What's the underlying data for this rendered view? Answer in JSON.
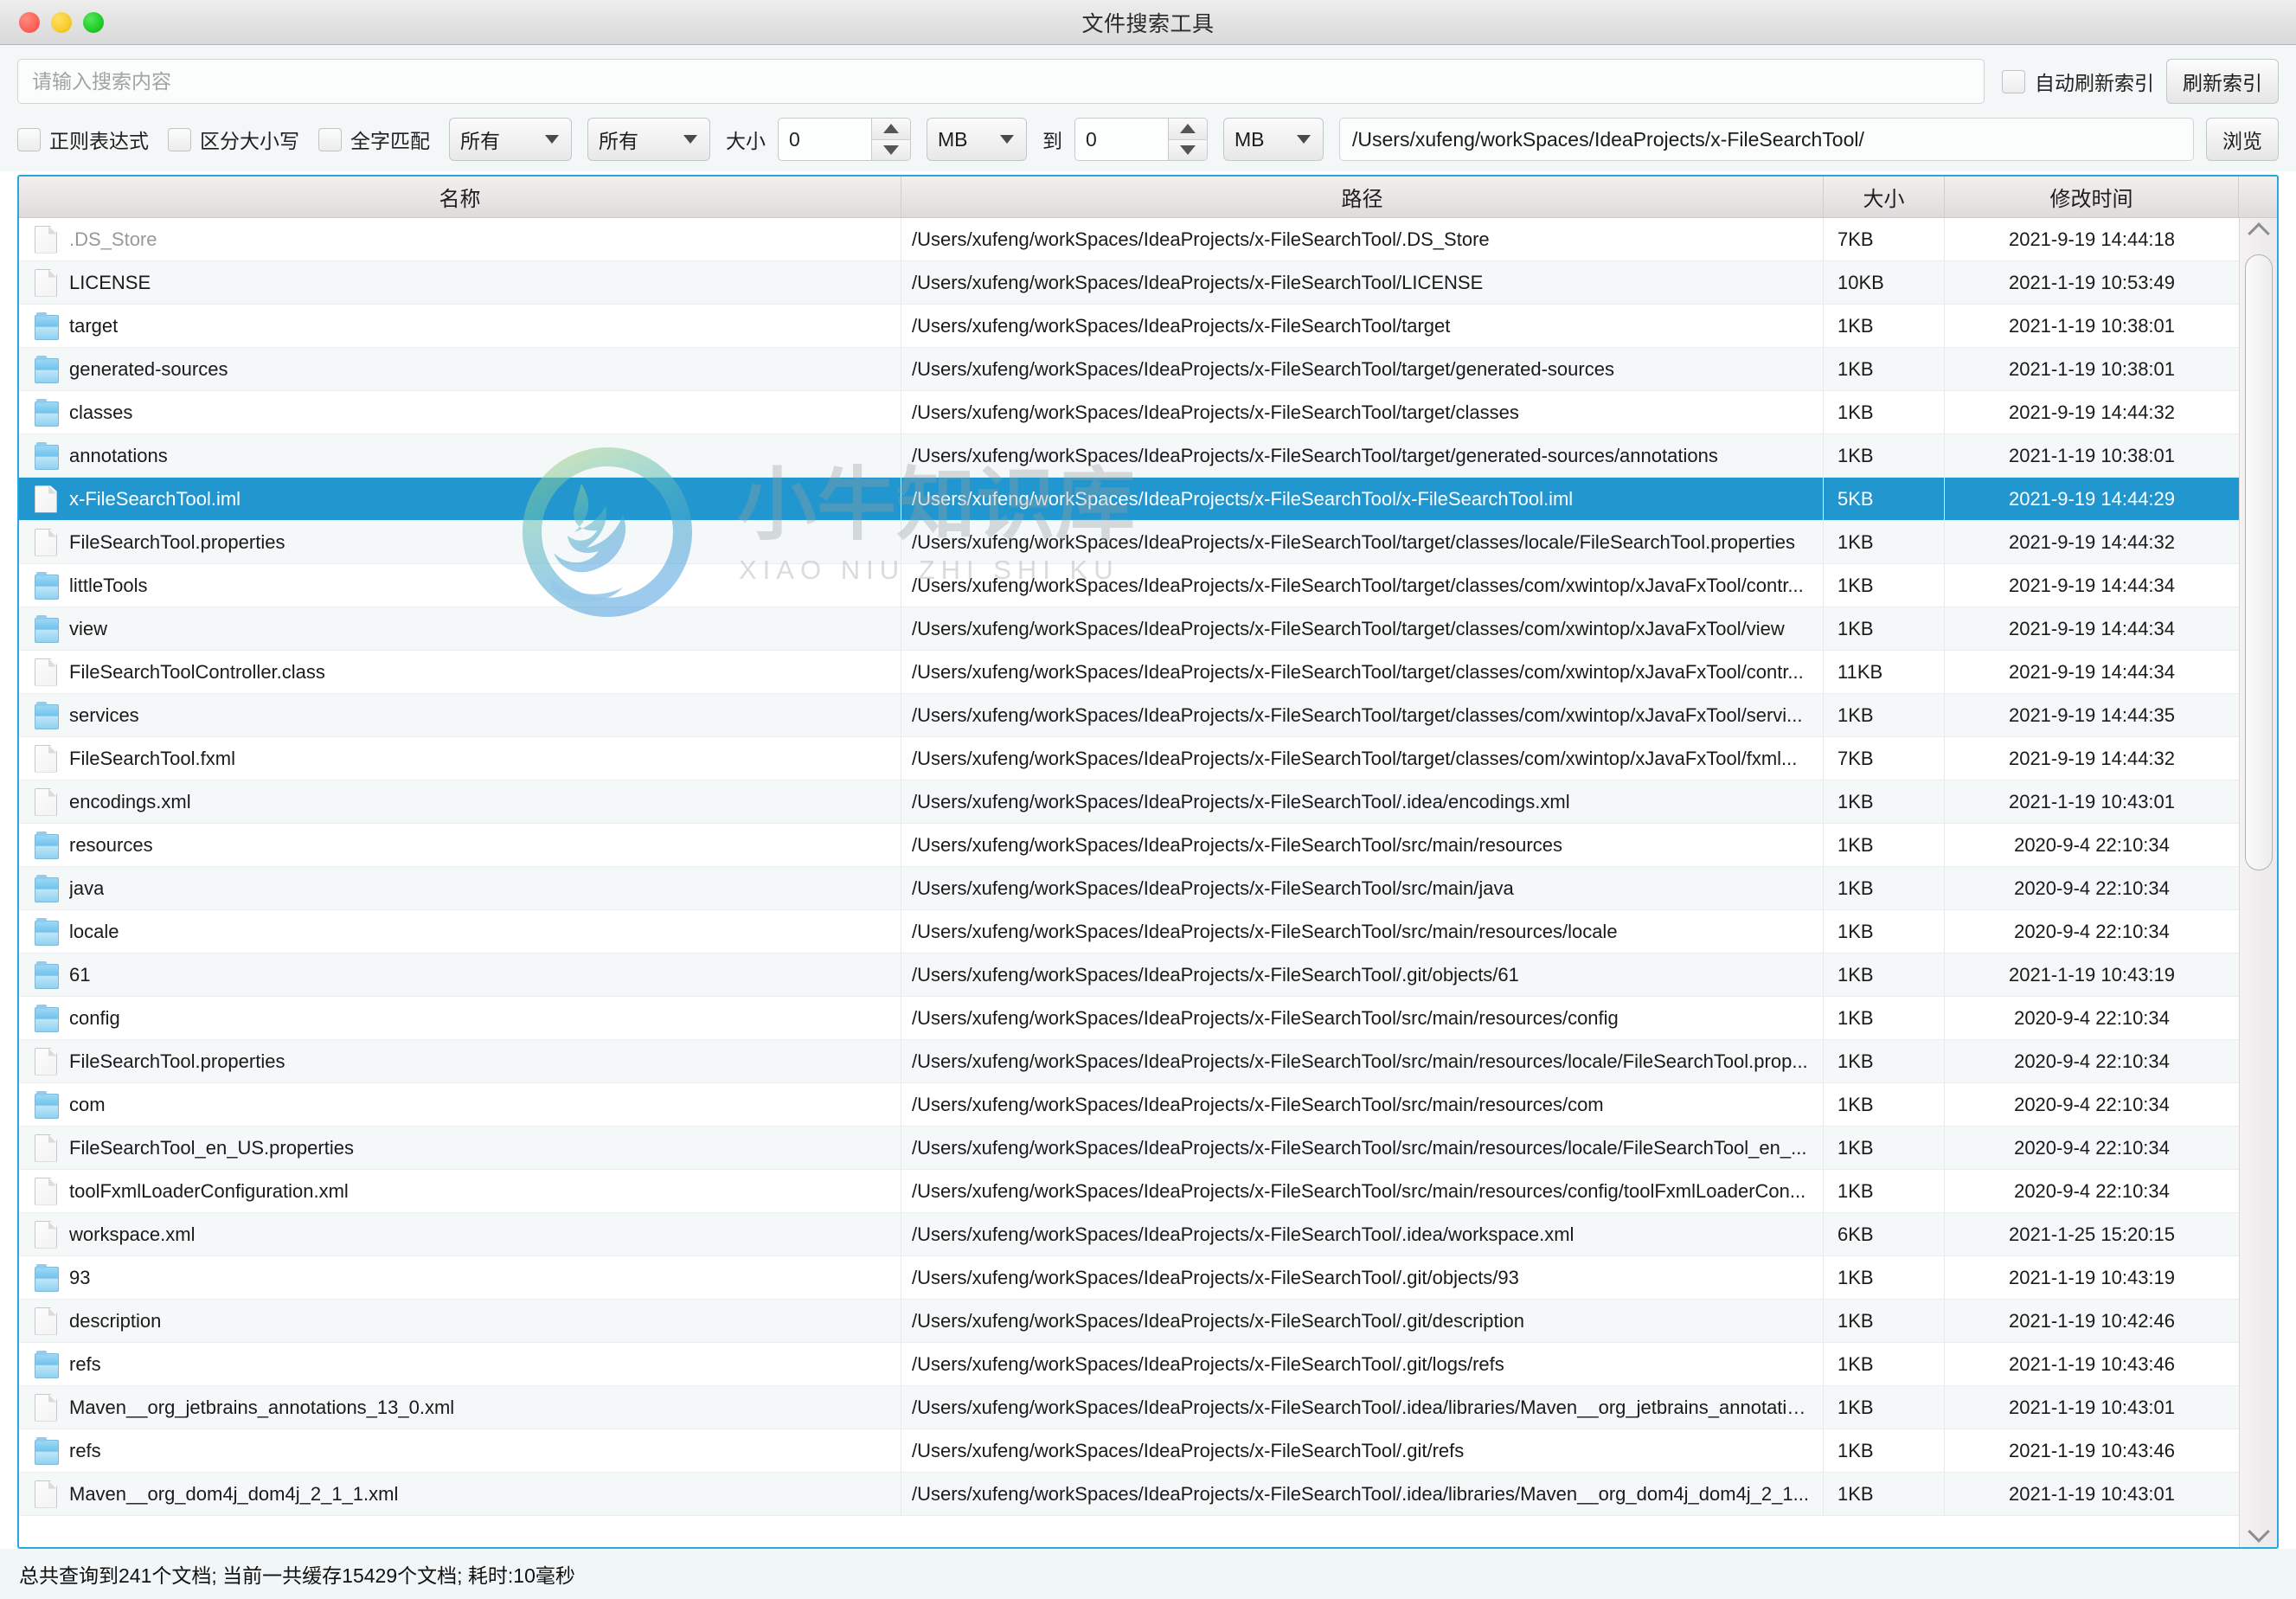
{
  "window": {
    "title": "文件搜索工具",
    "traffic_lights": [
      "close",
      "minimize",
      "zoom"
    ]
  },
  "toolbar": {
    "search_placeholder": "请输入搜索内容",
    "search_value": "",
    "auto_refresh_label": "自动刷新索引",
    "auto_refresh_checked": false,
    "refresh_index_label": "刷新索引",
    "regex_label": "正则表达式",
    "regex_checked": false,
    "case_label": "区分大小写",
    "case_checked": false,
    "wholeword_label": "全字匹配",
    "wholeword_checked": false,
    "type_combo_value": "所有",
    "scope_combo_value": "所有",
    "size_label": "大小",
    "size_from_value": "0",
    "size_from_unit": "MB",
    "to_label": "到",
    "size_to_value": "0",
    "size_to_unit": "MB",
    "path_value": "/Users/xufeng/workSpaces/IdeaProjects/x-FileSearchTool/",
    "browse_label": "浏览"
  },
  "table": {
    "columns": [
      "名称",
      "路径",
      "大小",
      "修改时间"
    ],
    "selected_index": 6,
    "rows": [
      {
        "icon": "file",
        "name": ".DS_Store",
        "dim": true,
        "path": "/Users/xufeng/workSpaces/IdeaProjects/x-FileSearchTool/.DS_Store",
        "size": "7KB",
        "time": "2021-9-19 14:44:18"
      },
      {
        "icon": "file",
        "name": "LICENSE",
        "dim": false,
        "path": "/Users/xufeng/workSpaces/IdeaProjects/x-FileSearchTool/LICENSE",
        "size": "10KB",
        "time": "2021-1-19 10:53:49"
      },
      {
        "icon": "folder",
        "name": "target",
        "dim": false,
        "path": "/Users/xufeng/workSpaces/IdeaProjects/x-FileSearchTool/target",
        "size": "1KB",
        "time": "2021-1-19 10:38:01"
      },
      {
        "icon": "folder",
        "name": "generated-sources",
        "dim": false,
        "path": "/Users/xufeng/workSpaces/IdeaProjects/x-FileSearchTool/target/generated-sources",
        "size": "1KB",
        "time": "2021-1-19 10:38:01"
      },
      {
        "icon": "folder",
        "name": "classes",
        "dim": false,
        "path": "/Users/xufeng/workSpaces/IdeaProjects/x-FileSearchTool/target/classes",
        "size": "1KB",
        "time": "2021-9-19 14:44:32"
      },
      {
        "icon": "folder",
        "name": "annotations",
        "dim": false,
        "path": "/Users/xufeng/workSpaces/IdeaProjects/x-FileSearchTool/target/generated-sources/annotations",
        "size": "1KB",
        "time": "2021-1-19 10:38:01"
      },
      {
        "icon": "file",
        "name": "x-FileSearchTool.iml",
        "dim": false,
        "path": "/Users/xufeng/workSpaces/IdeaProjects/x-FileSearchTool/x-FileSearchTool.iml",
        "size": "5KB",
        "time": "2021-9-19 14:44:29"
      },
      {
        "icon": "file",
        "name": "FileSearchTool.properties",
        "dim": false,
        "path": "/Users/xufeng/workSpaces/IdeaProjects/x-FileSearchTool/target/classes/locale/FileSearchTool.properties",
        "size": "1KB",
        "time": "2021-9-19 14:44:32"
      },
      {
        "icon": "folder",
        "name": "littleTools",
        "dim": false,
        "path": "/Users/xufeng/workSpaces/IdeaProjects/x-FileSearchTool/target/classes/com/xwintop/xJavaFxTool/contr...",
        "size": "1KB",
        "time": "2021-9-19 14:44:34"
      },
      {
        "icon": "folder",
        "name": "view",
        "dim": false,
        "path": "/Users/xufeng/workSpaces/IdeaProjects/x-FileSearchTool/target/classes/com/xwintop/xJavaFxTool/view",
        "size": "1KB",
        "time": "2021-9-19 14:44:34"
      },
      {
        "icon": "file",
        "name": "FileSearchToolController.class",
        "dim": false,
        "path": "/Users/xufeng/workSpaces/IdeaProjects/x-FileSearchTool/target/classes/com/xwintop/xJavaFxTool/contr...",
        "size": "11KB",
        "time": "2021-9-19 14:44:34"
      },
      {
        "icon": "folder",
        "name": "services",
        "dim": false,
        "path": "/Users/xufeng/workSpaces/IdeaProjects/x-FileSearchTool/target/classes/com/xwintop/xJavaFxTool/servi...",
        "size": "1KB",
        "time": "2021-9-19 14:44:35"
      },
      {
        "icon": "file",
        "name": "FileSearchTool.fxml",
        "dim": false,
        "path": "/Users/xufeng/workSpaces/IdeaProjects/x-FileSearchTool/target/classes/com/xwintop/xJavaFxTool/fxml...",
        "size": "7KB",
        "time": "2021-9-19 14:44:32"
      },
      {
        "icon": "file",
        "name": "encodings.xml",
        "dim": false,
        "path": "/Users/xufeng/workSpaces/IdeaProjects/x-FileSearchTool/.idea/encodings.xml",
        "size": "1KB",
        "time": "2021-1-19 10:43:01"
      },
      {
        "icon": "folder",
        "name": "resources",
        "dim": false,
        "path": "/Users/xufeng/workSpaces/IdeaProjects/x-FileSearchTool/src/main/resources",
        "size": "1KB",
        "time": "2020-9-4 22:10:34"
      },
      {
        "icon": "folder",
        "name": "java",
        "dim": false,
        "path": "/Users/xufeng/workSpaces/IdeaProjects/x-FileSearchTool/src/main/java",
        "size": "1KB",
        "time": "2020-9-4 22:10:34"
      },
      {
        "icon": "folder",
        "name": "locale",
        "dim": false,
        "path": "/Users/xufeng/workSpaces/IdeaProjects/x-FileSearchTool/src/main/resources/locale",
        "size": "1KB",
        "time": "2020-9-4 22:10:34"
      },
      {
        "icon": "folder",
        "name": "61",
        "dim": false,
        "path": "/Users/xufeng/workSpaces/IdeaProjects/x-FileSearchTool/.git/objects/61",
        "size": "1KB",
        "time": "2021-1-19 10:43:19"
      },
      {
        "icon": "folder",
        "name": "config",
        "dim": false,
        "path": "/Users/xufeng/workSpaces/IdeaProjects/x-FileSearchTool/src/main/resources/config",
        "size": "1KB",
        "time": "2020-9-4 22:10:34"
      },
      {
        "icon": "file",
        "name": "FileSearchTool.properties",
        "dim": false,
        "path": "/Users/xufeng/workSpaces/IdeaProjects/x-FileSearchTool/src/main/resources/locale/FileSearchTool.prop...",
        "size": "1KB",
        "time": "2020-9-4 22:10:34"
      },
      {
        "icon": "folder",
        "name": "com",
        "dim": false,
        "path": "/Users/xufeng/workSpaces/IdeaProjects/x-FileSearchTool/src/main/resources/com",
        "size": "1KB",
        "time": "2020-9-4 22:10:34"
      },
      {
        "icon": "file",
        "name": "FileSearchTool_en_US.properties",
        "dim": false,
        "path": "/Users/xufeng/workSpaces/IdeaProjects/x-FileSearchTool/src/main/resources/locale/FileSearchTool_en_...",
        "size": "1KB",
        "time": "2020-9-4 22:10:34"
      },
      {
        "icon": "file",
        "name": "toolFxmlLoaderConfiguration.xml",
        "dim": false,
        "path": "/Users/xufeng/workSpaces/IdeaProjects/x-FileSearchTool/src/main/resources/config/toolFxmlLoaderCon...",
        "size": "1KB",
        "time": "2020-9-4 22:10:34"
      },
      {
        "icon": "file",
        "name": "workspace.xml",
        "dim": false,
        "path": "/Users/xufeng/workSpaces/IdeaProjects/x-FileSearchTool/.idea/workspace.xml",
        "size": "6KB",
        "time": "2021-1-25 15:20:15"
      },
      {
        "icon": "folder",
        "name": "93",
        "dim": false,
        "path": "/Users/xufeng/workSpaces/IdeaProjects/x-FileSearchTool/.git/objects/93",
        "size": "1KB",
        "time": "2021-1-19 10:43:19"
      },
      {
        "icon": "file",
        "name": "description",
        "dim": false,
        "path": "/Users/xufeng/workSpaces/IdeaProjects/x-FileSearchTool/.git/description",
        "size": "1KB",
        "time": "2021-1-19 10:42:46"
      },
      {
        "icon": "folder",
        "name": "refs",
        "dim": false,
        "path": "/Users/xufeng/workSpaces/IdeaProjects/x-FileSearchTool/.git/logs/refs",
        "size": "1KB",
        "time": "2021-1-19 10:43:46"
      },
      {
        "icon": "file",
        "name": "Maven__org_jetbrains_annotations_13_0.xml",
        "dim": false,
        "path": "/Users/xufeng/workSpaces/IdeaProjects/x-FileSearchTool/.idea/libraries/Maven__org_jetbrains_annotatio...",
        "size": "1KB",
        "time": "2021-1-19 10:43:01"
      },
      {
        "icon": "folder",
        "name": "refs",
        "dim": false,
        "path": "/Users/xufeng/workSpaces/IdeaProjects/x-FileSearchTool/.git/refs",
        "size": "1KB",
        "time": "2021-1-19 10:43:46"
      },
      {
        "icon": "file",
        "name": "Maven__org_dom4j_dom4j_2_1_1.xml",
        "dim": false,
        "path": "/Users/xufeng/workSpaces/IdeaProjects/x-FileSearchTool/.idea/libraries/Maven__org_dom4j_dom4j_2_1...",
        "size": "1KB",
        "time": "2021-1-19 10:43:01"
      }
    ]
  },
  "watermark": {
    "text_cn": "小牛知识库",
    "text_py": "XIAO NIU ZHI SHI KU"
  },
  "statusbar": {
    "text": "总共查询到241个文档; 当前一共缓存15429个文档; 耗时:10毫秒"
  },
  "colors": {
    "selection": "#2196cf",
    "panel_border": "#27a8dd",
    "background": "#f3f7f7"
  }
}
